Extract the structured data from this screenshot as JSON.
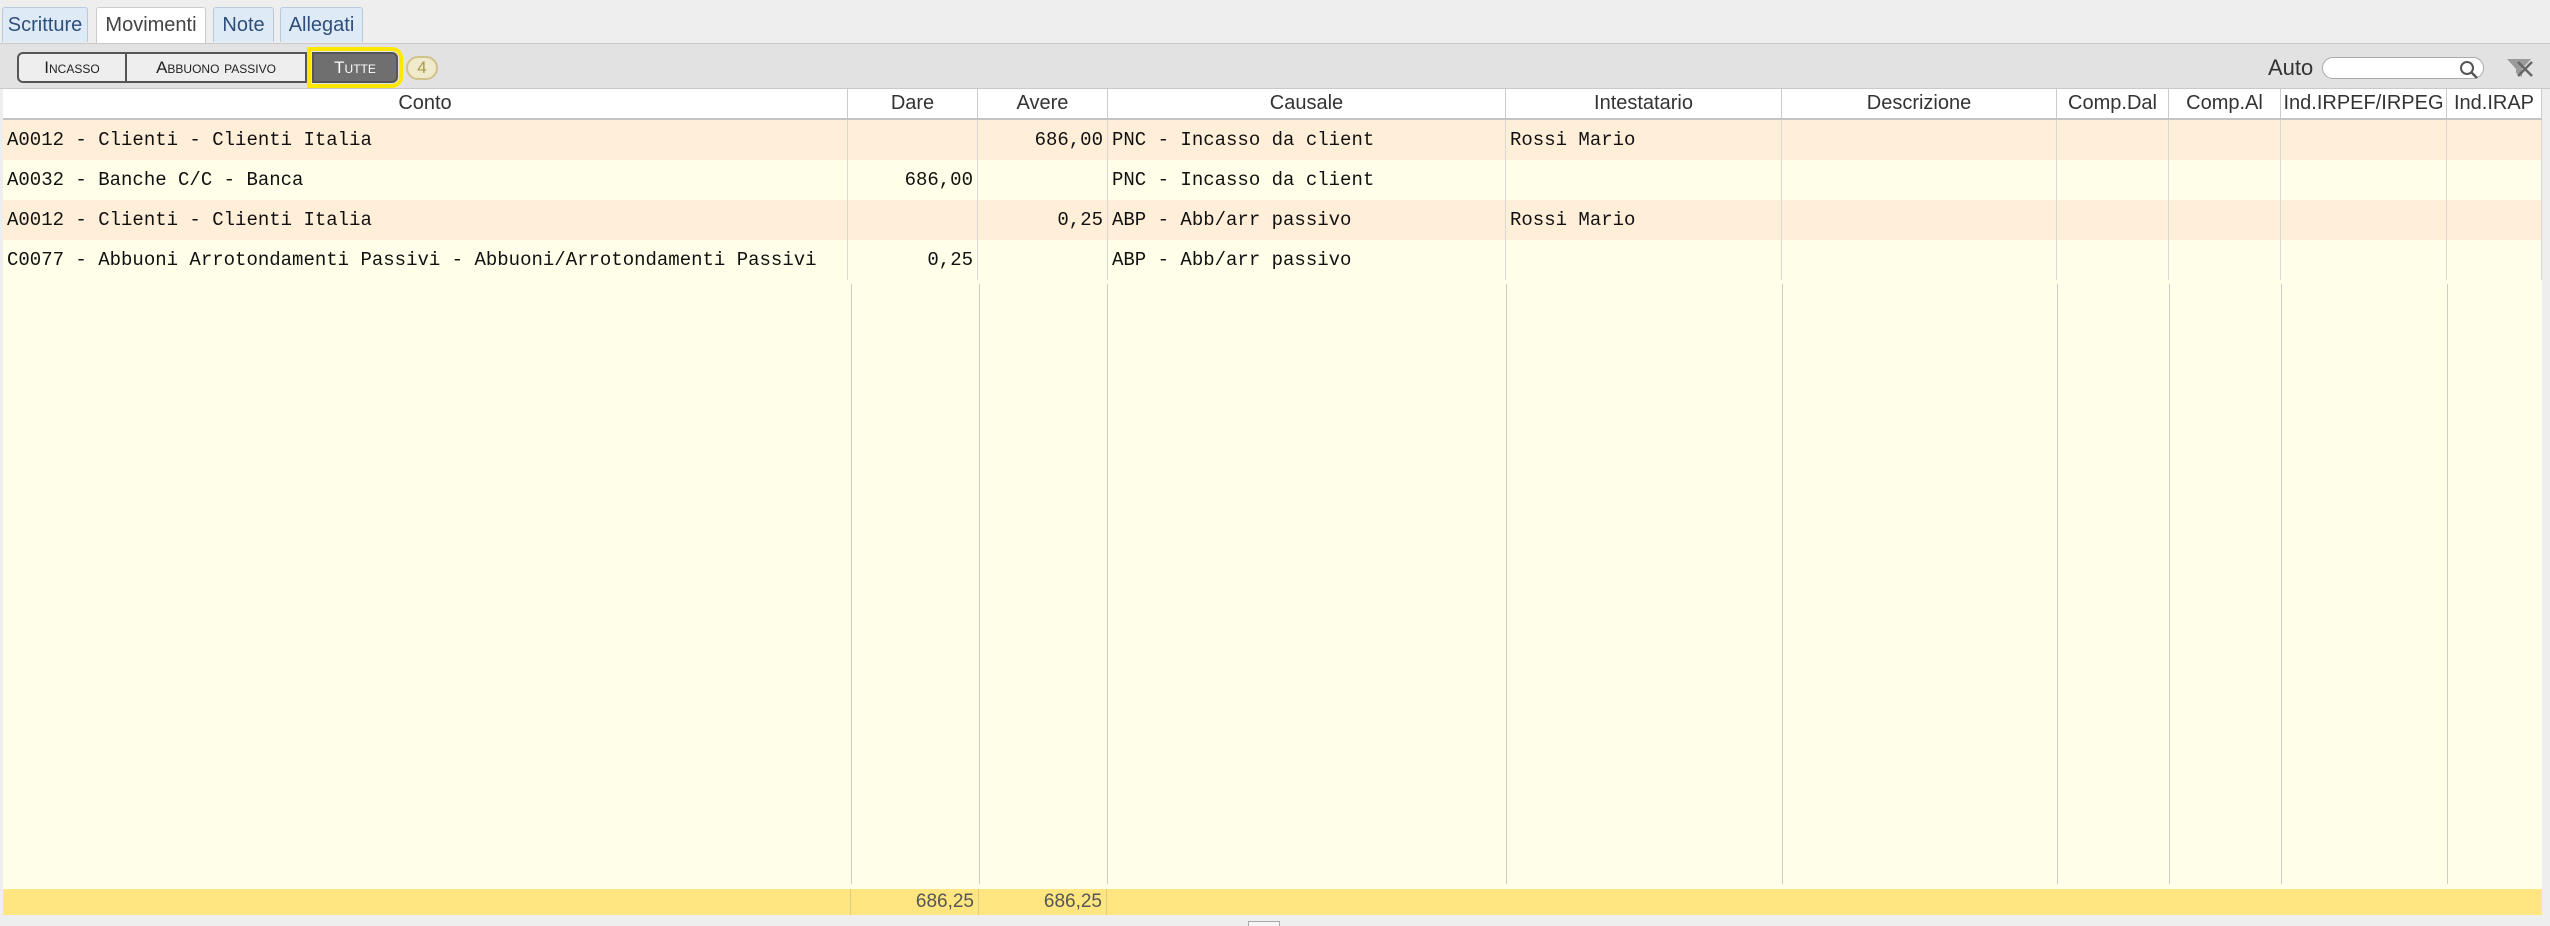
{
  "tabs": [
    {
      "label": "Scritture",
      "active": false
    },
    {
      "label": "Movimenti",
      "active": true
    },
    {
      "label": "Note",
      "active": false
    },
    {
      "label": "Allegati",
      "active": false
    }
  ],
  "toolbar": {
    "filters": [
      "Incasso",
      "Abbuono passivo",
      "Tutte"
    ],
    "selected_filter": "Tutte",
    "count": "4",
    "auto_label": "Auto",
    "search_value": "",
    "accent_color": "#ffe800"
  },
  "table": {
    "columns": [
      "Conto",
      "Dare",
      "Avere",
      "Causale",
      "Intestatario",
      "Descrizione",
      "Comp.Dal",
      "Comp.Al",
      "Ind.IRPEF/IRPEG",
      "Ind.IRAP"
    ],
    "rows": [
      {
        "conto": "A0012 - Clienti - Clienti Italia",
        "dare": "",
        "avere": "686,00",
        "causale": "PNC - Incasso da client",
        "intestatario": "Rossi Mario",
        "descrizione": "",
        "comp_dal": "",
        "comp_al": "",
        "ind_irpef": "",
        "ind_irap": ""
      },
      {
        "conto": "A0032 - Banche C/C - Banca",
        "dare": "686,00",
        "avere": "",
        "causale": "PNC - Incasso da client",
        "intestatario": "",
        "descrizione": "",
        "comp_dal": "",
        "comp_al": "",
        "ind_irpef": "",
        "ind_irap": ""
      },
      {
        "conto": "A0012 - Clienti - Clienti Italia",
        "dare": "",
        "avere": "0,25",
        "causale": "ABP - Abb/arr passivo",
        "intestatario": "Rossi Mario",
        "descrizione": "",
        "comp_dal": "",
        "comp_al": "",
        "ind_irpef": "",
        "ind_irap": ""
      },
      {
        "conto": "C0077 - Abbuoni Arrotondamenti Passivi - Abbuoni/Arrotondamenti Passivi",
        "dare": "0,25",
        "avere": "",
        "causale": "ABP - Abb/arr passivo",
        "intestatario": "",
        "descrizione": "",
        "comp_dal": "",
        "comp_al": "",
        "ind_irpef": "",
        "ind_irap": ""
      }
    ],
    "totals": {
      "dare": "686,25",
      "avere": "686,25"
    }
  },
  "icons": {
    "search": "search-icon",
    "clear_filter": "clear-filter-icon"
  }
}
